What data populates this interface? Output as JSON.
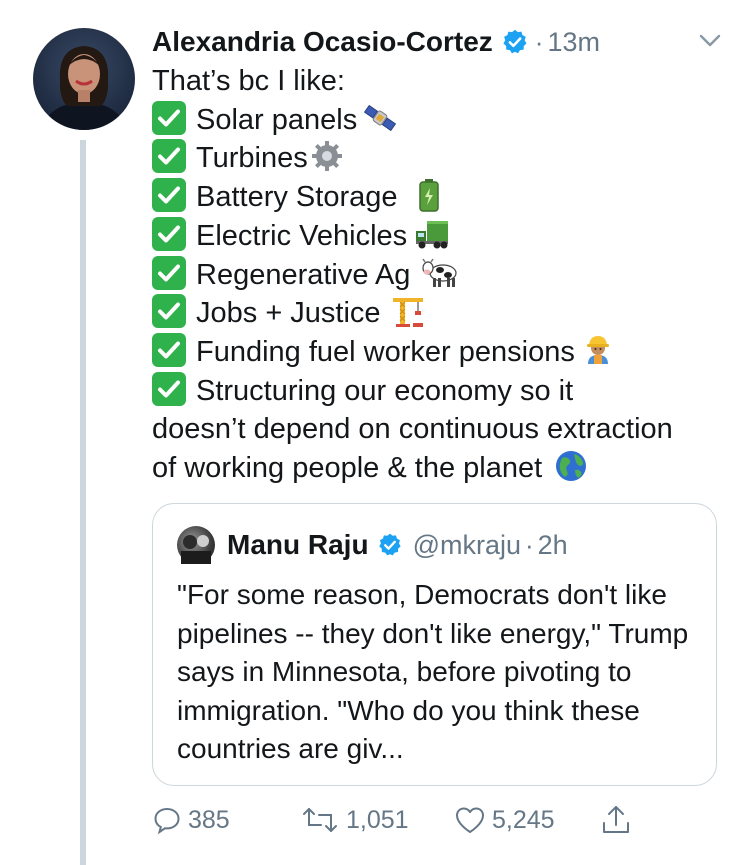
{
  "tweet": {
    "author_name": "Alexandria Ocasio-Cortez",
    "separator": "·",
    "time": "13m",
    "intro": "That’s bc I like:",
    "items": [
      {
        "label": "Solar panels",
        "emoji": "satellite"
      },
      {
        "label": "Turbines",
        "emoji": "gear"
      },
      {
        "label": "Battery Storage",
        "emoji": "battery"
      },
      {
        "label": "Electric Vehicles",
        "emoji": "truck"
      },
      {
        "label": "Regenerative Ag",
        "emoji": "cow"
      },
      {
        "label": "Jobs + Justice",
        "emoji": "crane"
      },
      {
        "label": "Funding fuel worker pensions",
        "emoji": "construction-worker"
      }
    ],
    "last_item_line1": "Structuring our economy so it",
    "last_item_line2": "doesn’t depend on continuous extraction",
    "last_item_line3": "of working people & the planet",
    "colors": {
      "verified": "#1da1f2",
      "check": "#2fb24c",
      "muted": "#657786",
      "border": "#ccd6dd"
    }
  },
  "quote": {
    "author_name": "Manu Raju",
    "handle": "@mkraju",
    "separator": "·",
    "time": "2h",
    "text": "\"For some reason, Democrats don't like pipelines -- they don't like energy,\" Trump says in Minnesota, before pivoting to immigration. \"Who do you think these countries are giv..."
  },
  "actions": {
    "reply_count": "385",
    "retweet_count": "1,051",
    "like_count": "5,245"
  }
}
